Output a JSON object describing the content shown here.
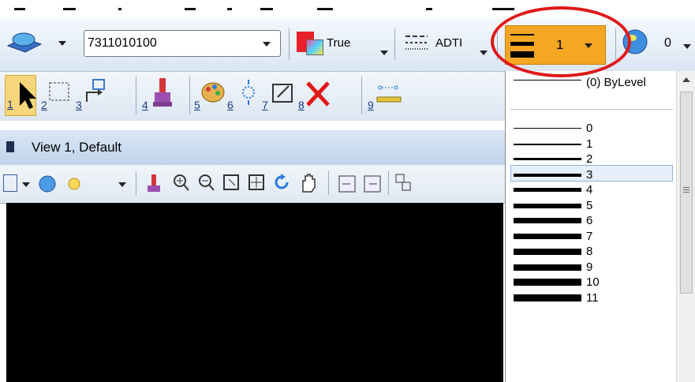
{
  "toolbar": {
    "level_value": "7311010100",
    "color_label": "True",
    "linestyle_label": "ADTI",
    "weight_value": "1",
    "transparency_value": "0",
    "colors": {
      "active_weight_bg": "#f5a623",
      "highlight_red": "#e01818",
      "color_swatch_red": "#e8202a"
    }
  },
  "tools": [
    {
      "num": "1",
      "icon": "select-arrow-icon"
    },
    {
      "num": "2",
      "icon": "fence-icon"
    },
    {
      "num": "3",
      "icon": "move-element-icon"
    },
    {
      "num": "4",
      "icon": "paint-brush-icon"
    },
    {
      "num": "5",
      "icon": "palette-icon"
    },
    {
      "num": "6",
      "icon": "sparkle-icon"
    },
    {
      "num": "7",
      "icon": "scale-icon"
    },
    {
      "num": "8",
      "icon": "delete-icon"
    },
    {
      "num": "9",
      "icon": "measure-icon"
    }
  ],
  "view": {
    "title": "View 1, Default"
  },
  "weight_menu": {
    "bylevel_label": "(0) ByLevel",
    "items": [
      {
        "label": "0",
        "thickness": 1
      },
      {
        "label": "1",
        "thickness": 2
      },
      {
        "label": "2",
        "thickness": 3
      },
      {
        "label": "3",
        "thickness": 4
      },
      {
        "label": "4",
        "thickness": 5
      },
      {
        "label": "5",
        "thickness": 6
      },
      {
        "label": "6",
        "thickness": 7
      },
      {
        "label": "7",
        "thickness": 7
      },
      {
        "label": "8",
        "thickness": 8
      },
      {
        "label": "9",
        "thickness": 8
      },
      {
        "label": "10",
        "thickness": 9
      },
      {
        "label": "11",
        "thickness": 9
      }
    ],
    "selected_index": 2
  }
}
